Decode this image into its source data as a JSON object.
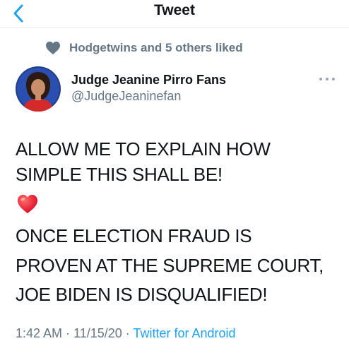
{
  "header": {
    "title": "Tweet"
  },
  "social_context": {
    "text": "Hodgetwins and 5 others liked"
  },
  "author": {
    "display_name": "Judge Jeanine Pirro Fans",
    "handle": "@JudgeJeaninefan"
  },
  "tweet": {
    "lines": [
      "ALLOW ME TO EXPLAIN HOW",
      "SIMPLE THIS SHALL BE!",
      "ONCE ELECTION FRAUD IS",
      "PROVEN AT THE SUPREME COURT,",
      "JOE BIDEN IS DISQUALIFIED!"
    ],
    "emoji": "red-heart"
  },
  "meta": {
    "time": "1:42 AM",
    "separator1": " · ",
    "date": "11/15/20",
    "separator2": " · ",
    "source": "Twitter for Android"
  },
  "colors": {
    "accent": "#1da1f2",
    "secondary_text": "#657786",
    "heart_red": "#e0245e"
  },
  "icons": {
    "back": "chevron-left-icon",
    "liked": "heart-icon",
    "more": "more-dots-icon"
  }
}
